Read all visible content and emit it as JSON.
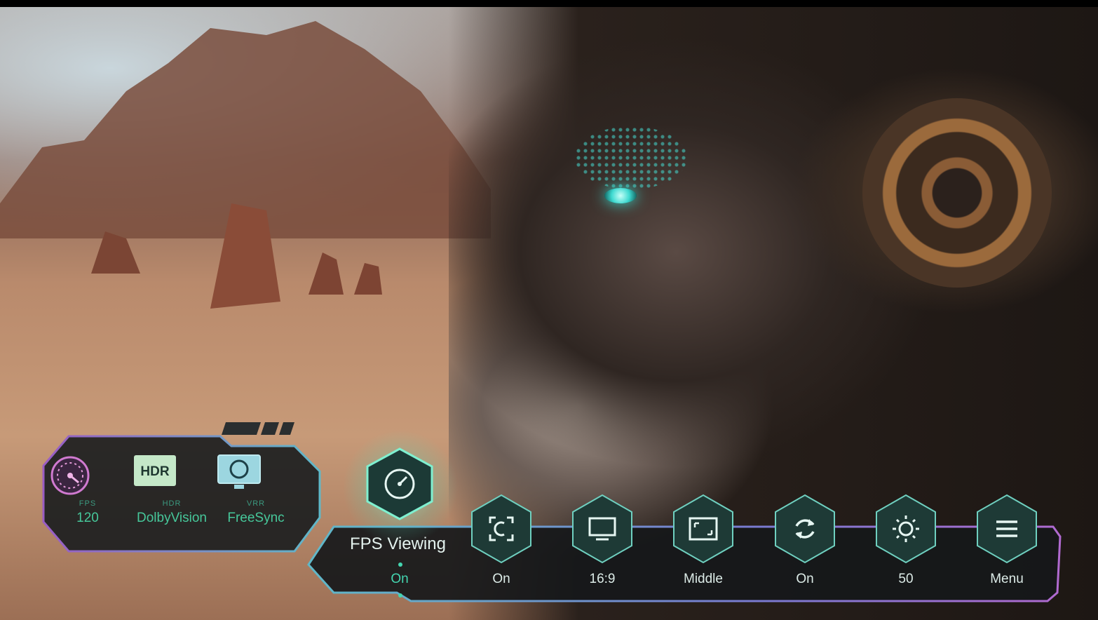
{
  "info_panel": {
    "items": [
      {
        "label": "FPS",
        "value": "120",
        "icon": "speedometer-icon"
      },
      {
        "label": "HDR",
        "value": "DolbyVision",
        "icon": "hdr-badge-icon",
        "badge": "HDR"
      },
      {
        "label": "VRR",
        "value": "FreeSync",
        "icon": "monitor-sync-icon"
      }
    ]
  },
  "game_bar": {
    "active_mode": {
      "title": "FPS Viewing",
      "value": "On",
      "icon": "speedometer-icon"
    },
    "buttons": [
      {
        "value": "On",
        "icon": "crosshair-icon"
      },
      {
        "value": "16:9",
        "icon": "monitor-icon"
      },
      {
        "value": "Middle",
        "icon": "screen-position-icon"
      },
      {
        "value": "On",
        "icon": "refresh-icon"
      },
      {
        "value": "50",
        "icon": "brightness-icon"
      },
      {
        "value": "Menu",
        "icon": "menu-icon"
      }
    ]
  },
  "colors": {
    "accent": "#44d6b0",
    "frame_purple": "#9a5cc4",
    "frame_teal": "#5fb8c8",
    "hex_fill": "#1e3a36"
  }
}
